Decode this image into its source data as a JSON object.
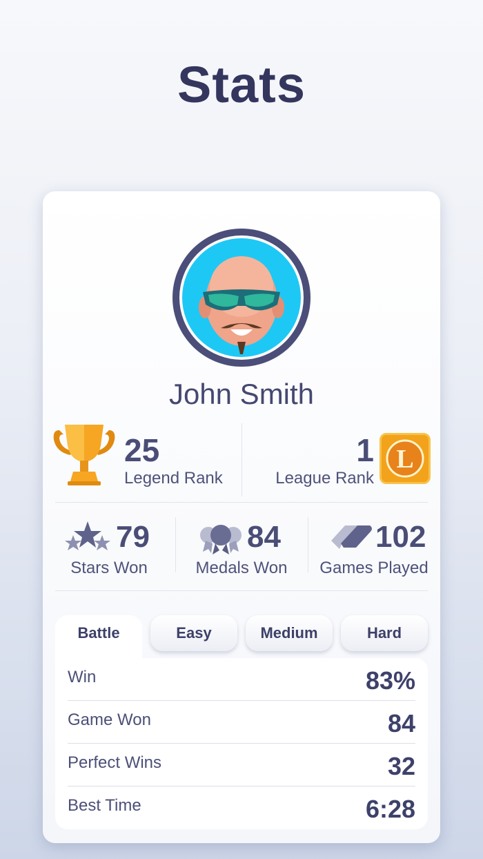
{
  "page": {
    "title": "Stats"
  },
  "profile": {
    "name": "John Smith",
    "avatar_icon": "bald-man-sunglasses-avatar"
  },
  "ranks": {
    "legend": {
      "value": "25",
      "label": "Legend Rank",
      "icon": "trophy-icon"
    },
    "league": {
      "value": "1",
      "label": "League Rank",
      "icon": "league-badge-icon",
      "badge_letter": "L"
    }
  },
  "stats": [
    {
      "value": "79",
      "label": "Stars Won",
      "icon": "stars-icon"
    },
    {
      "value": "84",
      "label": "Medals Won",
      "icon": "medals-icon"
    },
    {
      "value": "102",
      "label": "Games Played",
      "icon": "games-icon"
    }
  ],
  "tabs": [
    {
      "label": "Battle",
      "active": true
    },
    {
      "label": "Easy",
      "active": false
    },
    {
      "label": "Medium",
      "active": false
    },
    {
      "label": "Hard",
      "active": false
    }
  ],
  "table": [
    {
      "label": "Win",
      "value": "83%"
    },
    {
      "label": "Game Won",
      "value": "84"
    },
    {
      "label": "Perfect Wins",
      "value": "32"
    },
    {
      "label": "Best Time",
      "value": "6:28"
    }
  ],
  "colors": {
    "text_dark": "#34365e",
    "avatar_bg": "#1ec8f5",
    "trophy": "#f5a623",
    "league_badge": "#f2a21b"
  }
}
